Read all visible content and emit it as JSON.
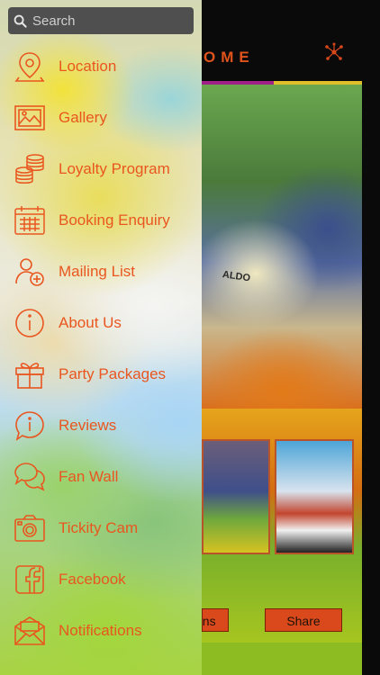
{
  "search": {
    "placeholder": "Search"
  },
  "menu": {
    "items": [
      {
        "label": "Location",
        "icon": "location-pin-icon"
      },
      {
        "label": "Gallery",
        "icon": "image-icon"
      },
      {
        "label": "Loyalty Program",
        "icon": "coins-icon"
      },
      {
        "label": "Booking Enquiry",
        "icon": "calendar-icon"
      },
      {
        "label": "Mailing List",
        "icon": "add-user-icon"
      },
      {
        "label": "About Us",
        "icon": "info-icon"
      },
      {
        "label": "Party Packages",
        "icon": "gift-icon"
      },
      {
        "label": "Reviews",
        "icon": "info-bubble-icon"
      },
      {
        "label": "Fan Wall",
        "icon": "chat-bubbles-icon"
      },
      {
        "label": "Tickity Cam",
        "icon": "camera-icon"
      },
      {
        "label": "Facebook",
        "icon": "facebook-icon"
      },
      {
        "label": "Notifications",
        "icon": "envelope-icon"
      }
    ]
  },
  "background_app": {
    "title_partial": "OME",
    "cake_text": "ALDO",
    "button_left_partial": "ons",
    "button_share": "Share"
  },
  "colors": {
    "accent": "#e9561f",
    "search_bg": "#4f4f4f"
  }
}
